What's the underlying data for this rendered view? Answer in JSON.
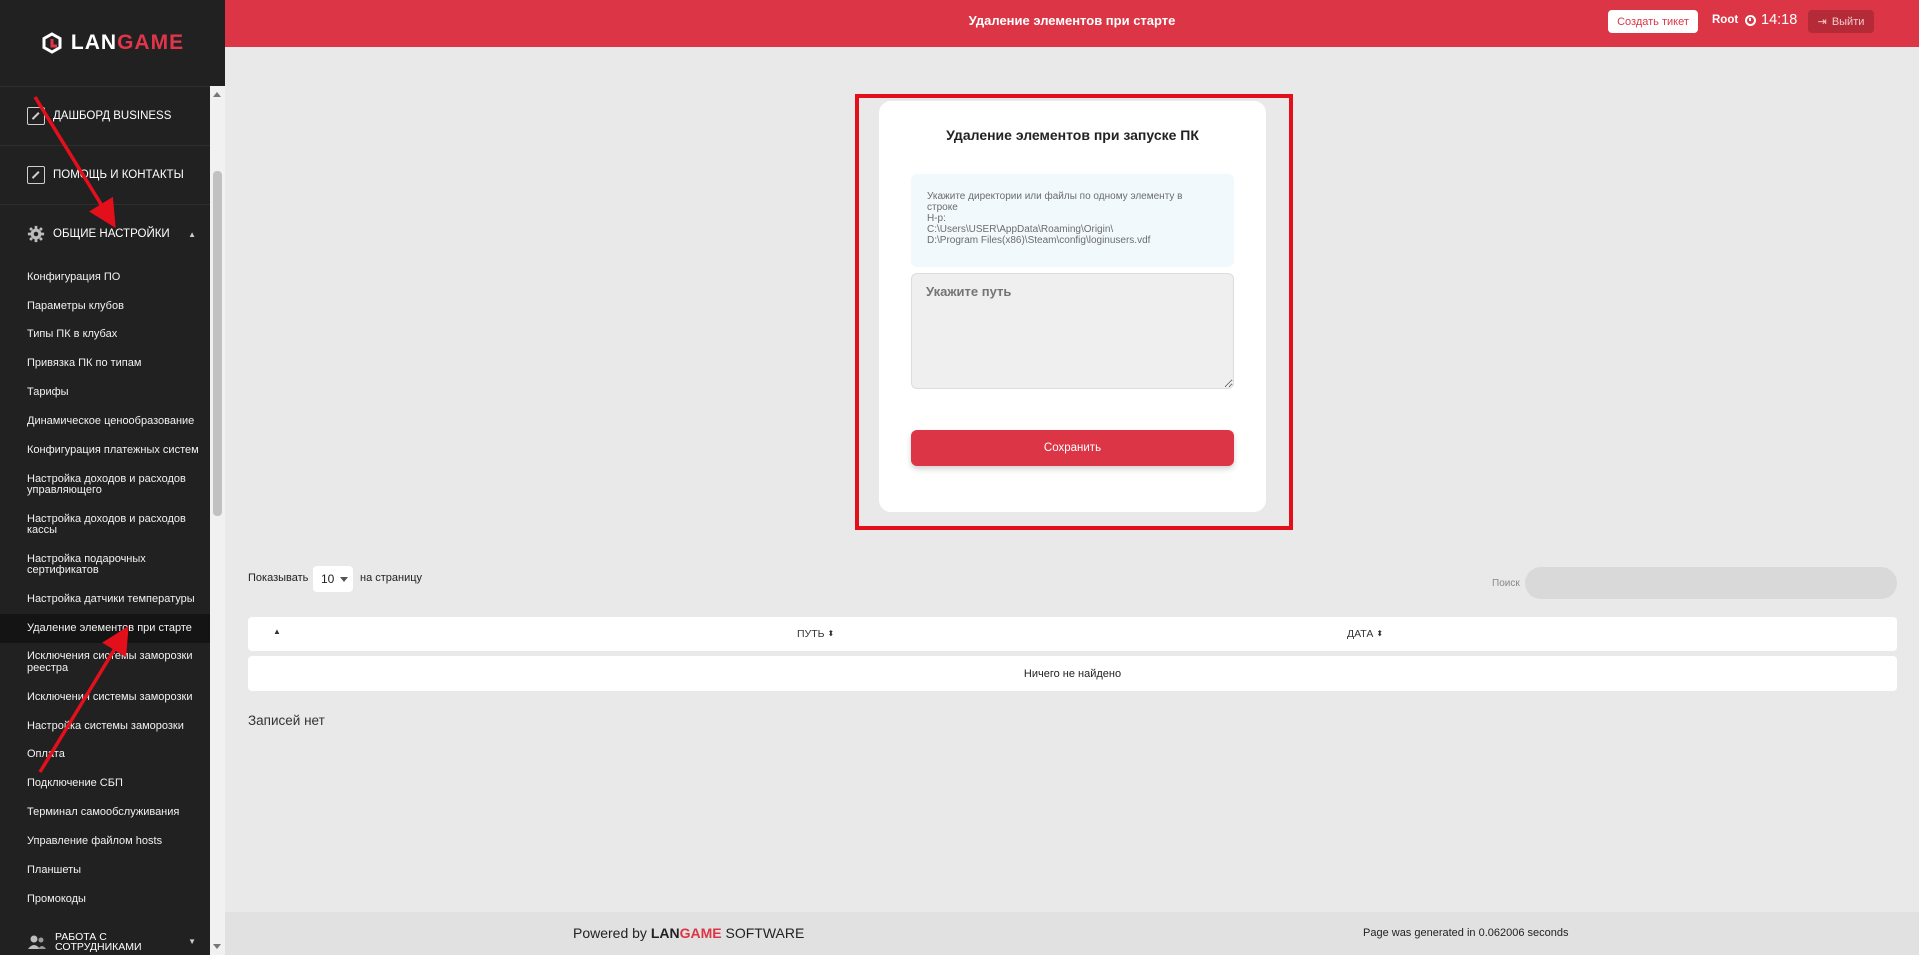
{
  "logo": {
    "part1": "LAN",
    "part2": "GAME"
  },
  "header": {
    "title": "Удаление элементов при старте",
    "create_ticket": "Создать тикет",
    "user": "Root",
    "time": "14:18",
    "logout": "Выйти"
  },
  "sidebar": {
    "main_items": [
      {
        "label": "ДАШБОРД BUSINESS",
        "icon": "edit-box-icon"
      },
      {
        "label": "ПОМОЩЬ И КОНТАКТЫ",
        "icon": "edit-box-icon"
      },
      {
        "label": "ОБЩИЕ НАСТРОЙКИ",
        "icon": "gear-icon"
      }
    ],
    "sub_items": [
      "Конфигурация ПО",
      "Параметры клубов",
      "Типы ПК в клубах",
      "Привязка ПК по типам",
      "Тарифы",
      "Динамическое ценообразование",
      "Конфигурация платежных систем",
      "Настройка доходов и расходов управляющего",
      "Настройка доходов и расходов кассы",
      "Настройка подарочных сертификатов",
      "Настройка датчики температуры",
      "Удаление элементов при старте",
      "Исключения системы заморозки реестра",
      "Исключения системы заморозки",
      "Настройка системы заморозки",
      "Оплата",
      "Подключение СБП",
      "Терминал самообслуживания",
      "Управление файлом hosts",
      "Планшеты",
      "Промокоды"
    ],
    "bottom_item": "РАБОТА С СОТРУДНИКАМИ"
  },
  "card": {
    "title": "Удаление элементов при запуске ПК",
    "hint_lines": [
      "Укажите директории или файлы по одному элементу в",
      "строке",
      "Н-р:",
      "C:\\Users\\USER\\AppData\\Roaming\\Origin\\",
      "D:\\Program Files(x86)\\Steam\\config\\loginusers.vdf"
    ],
    "textarea_placeholder": "Укажите путь",
    "save_label": "Сохранить"
  },
  "table": {
    "show_label": "Показывать",
    "page_size": "10",
    "per_page_label": "на страницу",
    "search_label": "Поиск",
    "columns": [
      "",
      "ПУТЬ",
      "ДАТА"
    ],
    "empty_text": "Ничего не найдено",
    "no_records": "Записей нет"
  },
  "footer": {
    "powered_prefix": "Powered by",
    "brand_part1": "LAN",
    "brand_part2": "GAME",
    "brand_suffix": "SOFTWARE",
    "generated": "Page was generated in 0.062006 seconds"
  },
  "colors": {
    "accent": "#dc3545",
    "sidebar": "#212121",
    "annotation": "#e3101c"
  }
}
